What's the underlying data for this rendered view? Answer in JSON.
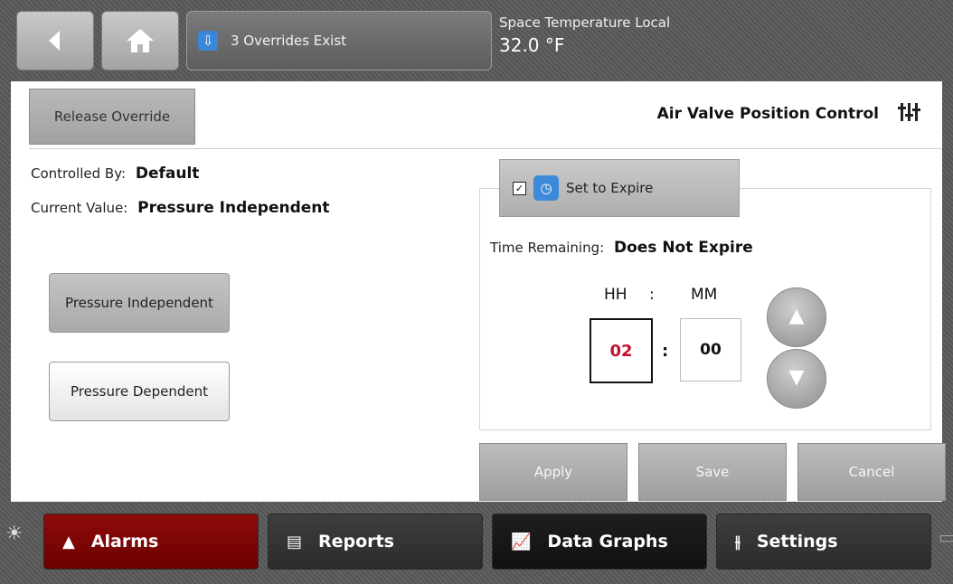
{
  "topbar": {
    "overrides_label": "3 Overrides Exist",
    "temp_label": "Space Temperature Local",
    "temp_value": "32.0 °F"
  },
  "panel": {
    "release_label": "Release Override",
    "title": "Air Valve Position Control",
    "controlled_by_label": "Controlled By:",
    "controlled_by_value": "Default",
    "current_value_label": "Current Value:",
    "current_value": "Pressure Independent",
    "options": [
      "Pressure Independent",
      "Pressure Dependent"
    ],
    "selected_option": "Pressure Independent"
  },
  "expire": {
    "checked": true,
    "label": "Set to Expire",
    "time_remaining_label": "Time Remaining:",
    "time_remaining_value": "Does Not Expire",
    "hh_label": "HH",
    "mm_label": "MM",
    "separator": ":",
    "hh_value": "02",
    "mm_value": "00"
  },
  "actions": {
    "apply": "Apply",
    "save": "Save",
    "cancel": "Cancel"
  },
  "nav": {
    "alarms": "Alarms",
    "reports": "Reports",
    "graphs": "Data Graphs",
    "settings": "Settings"
  },
  "colors": {
    "accent_blue": "#3b86d6",
    "alarm_red": "#8e0b0b",
    "hh_red": "#c8102e"
  },
  "icons": [
    "back-icon",
    "home-icon",
    "download-icon",
    "sliders-icon",
    "clock-icon",
    "chevron-up-icon",
    "chevron-down-icon",
    "sun-icon",
    "bell-icon",
    "document-icon",
    "chart-icon",
    "settings-icon",
    "chat-icon"
  ]
}
